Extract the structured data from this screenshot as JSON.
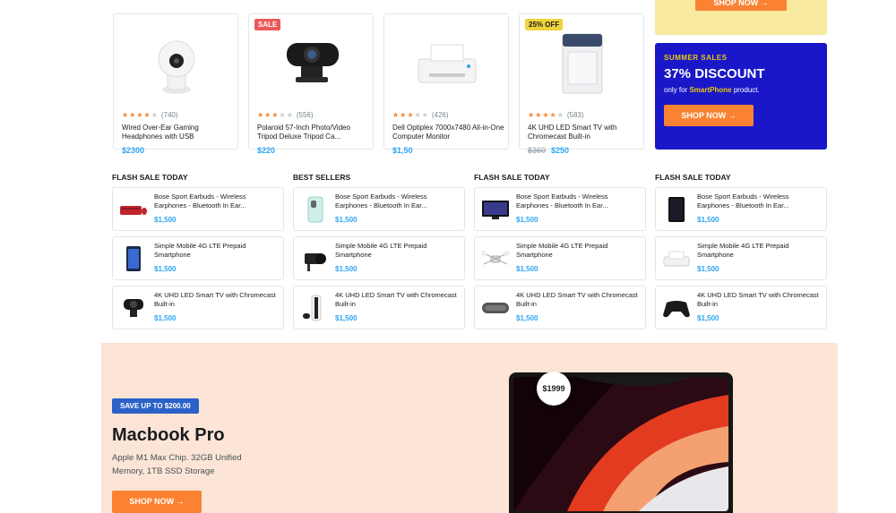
{
  "products": [
    {
      "badge": "",
      "reviews": "(740)",
      "stars": 4,
      "title": "Wired Over-Ear Gaming Headphones with USB",
      "old_price": "",
      "price": "$2300",
      "image": "security-camera-icon"
    },
    {
      "badge": "SALE",
      "reviews": "(556)",
      "stars": 3,
      "title": "Polaroid 57-Inch Photo/Video Tripod Deluxe Tripod Ca...",
      "old_price": "",
      "price": "$220",
      "image": "webcam-icon"
    },
    {
      "badge": "",
      "reviews": "(426)",
      "stars": 3,
      "title": "Dell Optiplex 7000x7480 All-in-One Computer Monitor",
      "old_price": "",
      "price": "$1,50",
      "image": "printer-icon"
    },
    {
      "badge": "25% OFF",
      "reviews": "(583)",
      "stars": 4,
      "title": "4K UHD LED Smart TV with Chromecast Built-in",
      "old_price": "$360",
      "price": "$250",
      "image": "washing-machine-icon"
    }
  ],
  "promo_top": {
    "button": "SHOP NOW →"
  },
  "promo_summer": {
    "tag": "SUMMER SALES",
    "headline": "37% DISCOUNT",
    "sub_prefix": "only for ",
    "sub_brand": "SmartPhone",
    "sub_suffix": " product.",
    "button": "SHOP NOW →"
  },
  "lists": [
    {
      "heading": "FLASH SALE TODAY",
      "items": [
        {
          "name": "Bose Sport Earbuds - Wireless Earphones - Bluetooth In Ear...",
          "price": "$1,500",
          "image": "keyboard-mouse-icon"
        },
        {
          "name": "Simple Mobile 4G LTE Prepaid Smartphone",
          "price": "$1,500",
          "image": "smartphone-icon"
        },
        {
          "name": "4K UHD LED Smart TV with Chromecast Built-in",
          "price": "$1,500",
          "image": "webcam-icon"
        }
      ]
    },
    {
      "heading": "BEST SELLERS",
      "items": [
        {
          "name": "Bose Sport Earbuds - Wireless Earphones - Bluetooth In Ear...",
          "price": "$1,500",
          "image": "phone-case-icon"
        },
        {
          "name": "Simple Mobile 4G LTE Prepaid Smartphone",
          "price": "$1,500",
          "image": "camera-icon"
        },
        {
          "name": "4K UHD LED Smart TV with Chromecast Built-in",
          "price": "$1,500",
          "image": "game-console-icon"
        }
      ]
    },
    {
      "heading": "FLASH SALE TODAY",
      "items": [
        {
          "name": "Bose Sport Earbuds - Wireless Earphones - Bluetooth In Ear...",
          "price": "$1,500",
          "image": "tv-icon"
        },
        {
          "name": "Simple Mobile 4G LTE Prepaid Smartphone",
          "price": "$1,500",
          "image": "drone-icon"
        },
        {
          "name": "4K UHD LED Smart TV with Chromecast Built-in",
          "price": "$1,500",
          "image": "speaker-icon"
        }
      ]
    },
    {
      "heading": "FLASH SALE TODAY",
      "items": [
        {
          "name": "Bose Sport Earbuds - Wireless Earphones - Bluetooth In Ear...",
          "price": "$1,500",
          "image": "tablet-icon"
        },
        {
          "name": "Simple Mobile 4G LTE Prepaid Smartphone",
          "price": "$1,500",
          "image": "printer-icon"
        },
        {
          "name": "4K UHD LED Smart TV with Chromecast Built-in",
          "price": "$1,500",
          "image": "gamepad-icon"
        }
      ]
    }
  ],
  "banner": {
    "badge": "SAVE UP TO $200.00",
    "title": "Macbook Pro",
    "description": "Apple M1 Max Chip. 32GB Unified Memory, 1TB SSD Storage",
    "button": "SHOP NOW →",
    "price": "$1999",
    "image": "laptop-icon"
  },
  "colors": {
    "accent": "#fa8232",
    "price": "#2da5f3",
    "promo_blue": "#1a17c8",
    "banner_bg": "#fce5d6"
  }
}
